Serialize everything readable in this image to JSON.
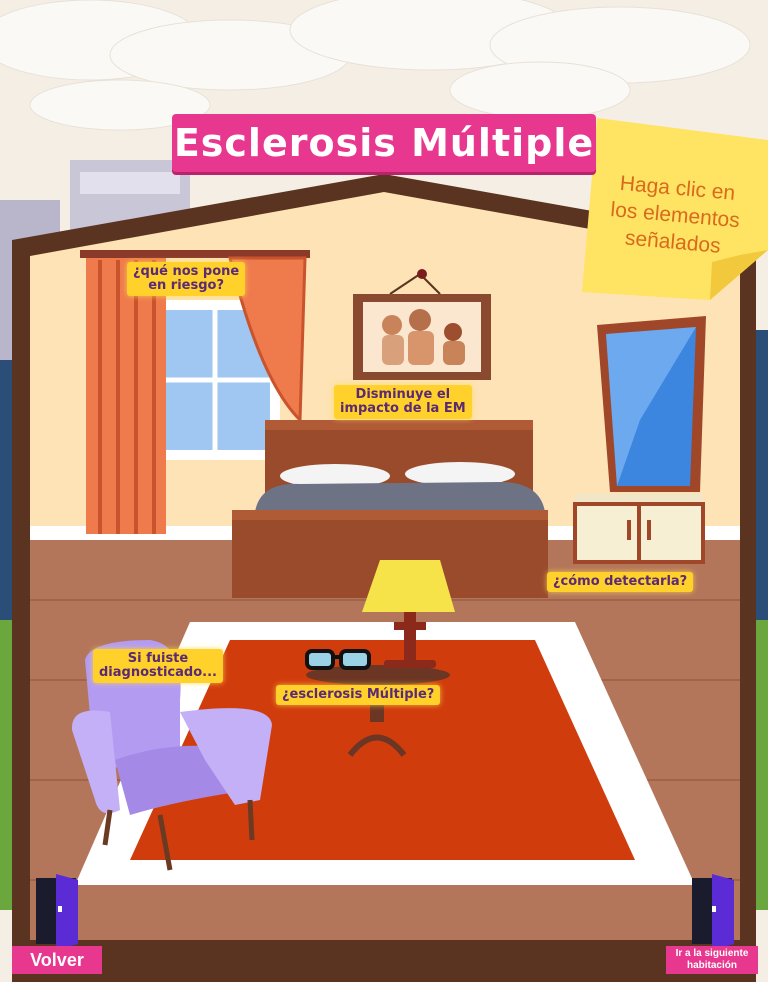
{
  "title": "Esclerosis Múltiple",
  "instruction": {
    "line1": "Haga clic en",
    "line2": "los elementos",
    "line3": "señalados"
  },
  "hotspots": {
    "riesgo": {
      "line1": "¿qué nos pone",
      "line2": "en riesgo?"
    },
    "impacto": {
      "line1": "Disminuye el",
      "line2": "impacto de la EM"
    },
    "detectarla": {
      "line1": "¿cómo detectarla?"
    },
    "diagnosticado": {
      "line1": "Si fuiste",
      "line2": "diagnosticado..."
    },
    "esclerosis": {
      "line1": "¿esclerosis Múltiple?"
    }
  },
  "nav": {
    "back": "Volver",
    "next_line1": "Ir a la siguiente",
    "next_line2": "habitación"
  },
  "colors": {
    "accent": "#e8378f",
    "label_bg": "#ffd12a",
    "label_text": "#5a2a75",
    "wall": "#fde3b5",
    "floor": "#b4765a",
    "rug": "#d13c0c"
  }
}
